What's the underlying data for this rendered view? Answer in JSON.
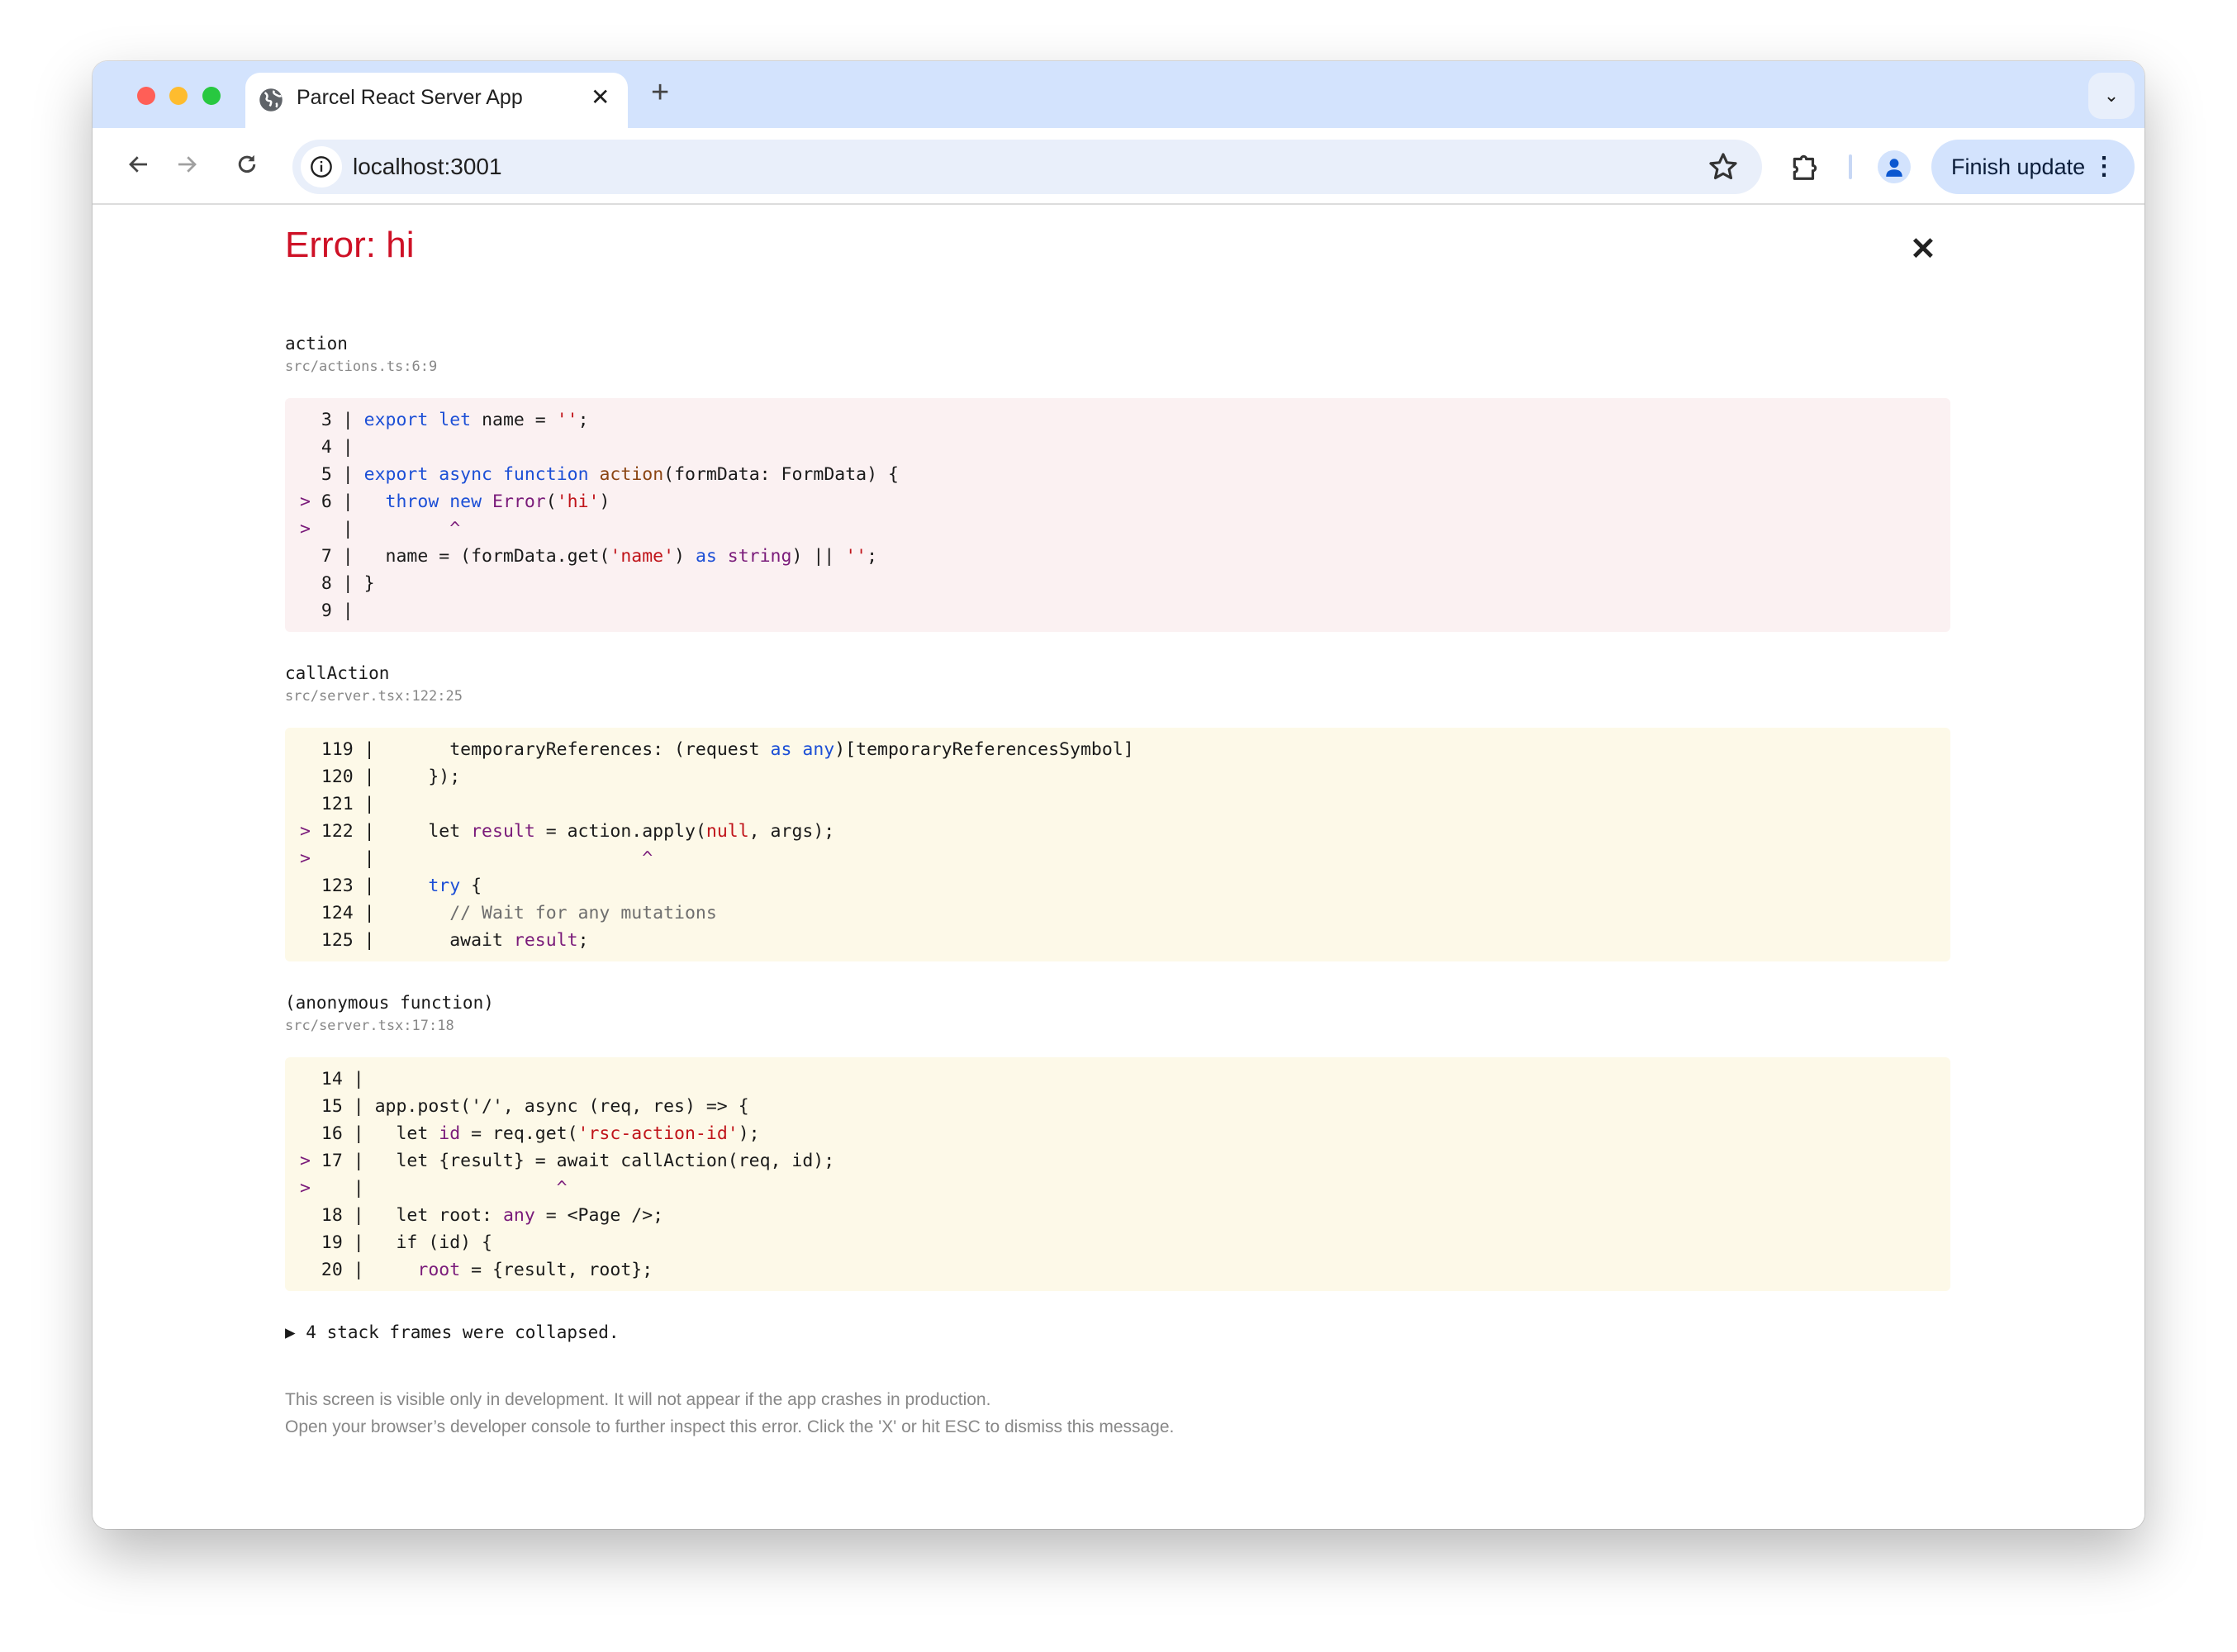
{
  "browser": {
    "tab_title": "Parcel React Server App",
    "url": "localhost:3001",
    "finish_update_label": "Finish update",
    "colors": {
      "tabbar": "#d3e3fd",
      "omnibox": "#e9effa",
      "close": "#ff5f57",
      "minimize": "#febc2e",
      "maximize": "#28c840"
    }
  },
  "overlay": {
    "title": "Error: hi",
    "close_label": "✕",
    "collapsed_label": "▶ 4 stack frames were collapsed.",
    "footer_line1": "This screen is visible only in development. It will not appear if the app crashes in production.",
    "footer_line2": "Open your browser’s developer console to further inspect this error.  Click the 'X' or hit ESC to dismiss this message.",
    "colors": {
      "error": "#ce1126",
      "highlight_frame": "#fbf1f2",
      "frame": "#fdf9e8"
    }
  },
  "frames": [
    {
      "name": "action",
      "file": "src/actions.ts:6:9",
      "bg": "#fbf1f2",
      "lines": [
        {
          "mark": "",
          "num": "3",
          "code": [
            [
              "export",
              "kw"
            ],
            [
              " ",
              ""
            ],
            [
              "let",
              "kw"
            ],
            [
              " name = ",
              ""
            ],
            [
              "''",
              "str"
            ],
            [
              ";",
              ""
            ]
          ]
        },
        {
          "mark": "",
          "num": "4",
          "code": []
        },
        {
          "mark": "",
          "num": "5",
          "code": [
            [
              "export",
              "kw"
            ],
            [
              " ",
              ""
            ],
            [
              "async",
              "kw"
            ],
            [
              " ",
              ""
            ],
            [
              "function",
              "kw"
            ],
            [
              " ",
              ""
            ],
            [
              "action",
              "fn"
            ],
            [
              "(formData: FormData) {",
              ""
            ]
          ]
        },
        {
          "mark": ">",
          "num": "6",
          "code": [
            [
              "  ",
              ""
            ],
            [
              "throw",
              "kw"
            ],
            [
              " ",
              ""
            ],
            [
              "new",
              "kw"
            ],
            [
              " ",
              ""
            ],
            [
              "Error",
              "var"
            ],
            [
              "(",
              ""
            ],
            [
              "'hi'",
              "str"
            ],
            [
              ")",
              ""
            ]
          ]
        },
        {
          "mark": ">",
          "num": "",
          "code": [
            [
              "        ^",
              "caret"
            ]
          ]
        },
        {
          "mark": "",
          "num": "7",
          "code": [
            [
              "  name = (formData.get(",
              ""
            ],
            [
              "'name'",
              "str"
            ],
            [
              ") ",
              ""
            ],
            [
              "as",
              "kw"
            ],
            [
              " ",
              ""
            ],
            [
              "string",
              "var"
            ],
            [
              ") || ",
              ""
            ],
            [
              "''",
              "str"
            ],
            [
              ";",
              ""
            ]
          ]
        },
        {
          "mark": "",
          "num": "8",
          "code": [
            [
              "}",
              ""
            ]
          ]
        },
        {
          "mark": "",
          "num": "9",
          "code": []
        }
      ]
    },
    {
      "name": "callAction",
      "file": "src/server.tsx:122:25",
      "bg": "#fdf9e8",
      "lines": [
        {
          "mark": "",
          "num": "119",
          "code": [
            [
              "      temporaryReferences: (request ",
              ""
            ],
            [
              "as",
              "kw"
            ],
            [
              " ",
              ""
            ],
            [
              "any",
              "kw"
            ],
            [
              ")[temporaryReferencesSymbol]",
              ""
            ]
          ]
        },
        {
          "mark": "",
          "num": "120",
          "code": [
            [
              "    });",
              ""
            ]
          ]
        },
        {
          "mark": "",
          "num": "121",
          "code": []
        },
        {
          "mark": ">",
          "num": "122",
          "code": [
            [
              "    let ",
              ""
            ],
            [
              "result",
              "var"
            ],
            [
              " = action.apply(",
              ""
            ],
            [
              "null",
              "str"
            ],
            [
              ", args);",
              ""
            ]
          ]
        },
        {
          "mark": ">",
          "num": "",
          "code": [
            [
              "                        ^",
              "caret"
            ]
          ]
        },
        {
          "mark": "",
          "num": "123",
          "code": [
            [
              "    ",
              ""
            ],
            [
              "try",
              "kw"
            ],
            [
              " {",
              ""
            ]
          ]
        },
        {
          "mark": "",
          "num": "124",
          "code": [
            [
              "      ",
              ""
            ],
            [
              "// Wait for any mutations",
              "cm"
            ]
          ]
        },
        {
          "mark": "",
          "num": "125",
          "code": [
            [
              "      await ",
              ""
            ],
            [
              "result",
              "var"
            ],
            [
              ";",
              ""
            ]
          ]
        }
      ]
    },
    {
      "name": "(anonymous function)",
      "file": "src/server.tsx:17:18",
      "bg": "#fdf9e8",
      "lines": [
        {
          "mark": "",
          "num": "14",
          "code": []
        },
        {
          "mark": "",
          "num": "15",
          "code": [
            [
              "app.post('/', async (req, res) => {",
              ""
            ]
          ]
        },
        {
          "mark": "",
          "num": "16",
          "code": [
            [
              "  let ",
              ""
            ],
            [
              "id",
              "var"
            ],
            [
              " = req.get(",
              ""
            ],
            [
              "'rsc-action-id'",
              "str"
            ],
            [
              ");",
              ""
            ]
          ]
        },
        {
          "mark": ">",
          "num": "17",
          "code": [
            [
              "  let {result} = await callAction(req, id);",
              ""
            ]
          ]
        },
        {
          "mark": ">",
          "num": "",
          "code": [
            [
              "                 ^",
              "caret"
            ]
          ]
        },
        {
          "mark": "",
          "num": "18",
          "code": [
            [
              "  let root: ",
              ""
            ],
            [
              "any",
              "var"
            ],
            [
              " = <Page />;",
              ""
            ]
          ]
        },
        {
          "mark": "",
          "num": "19",
          "code": [
            [
              "  if (id) {",
              ""
            ]
          ]
        },
        {
          "mark": "",
          "num": "20",
          "code": [
            [
              "    ",
              ""
            ],
            [
              "root",
              "var"
            ],
            [
              " = {result, root};",
              ""
            ]
          ]
        }
      ]
    }
  ]
}
